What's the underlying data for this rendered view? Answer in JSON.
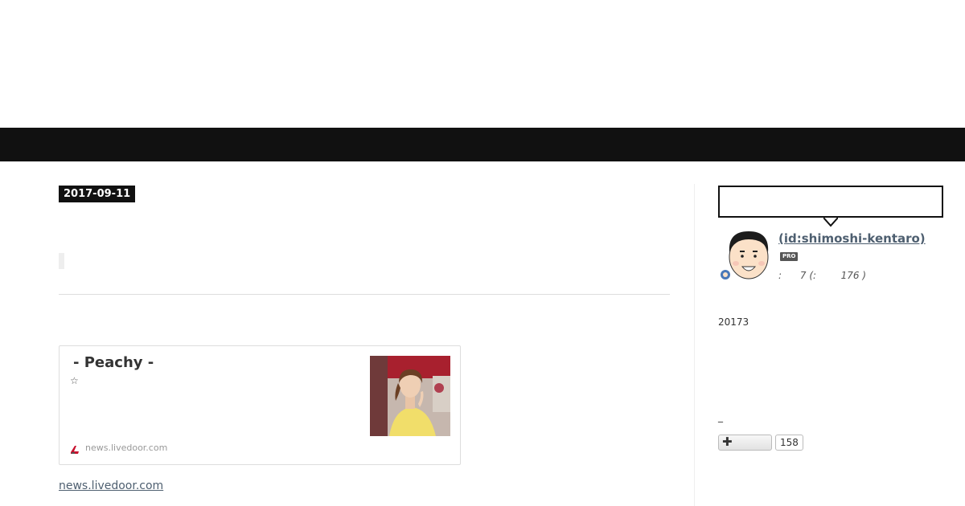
{
  "post": {
    "date": "2017-09-11"
  },
  "embed": {
    "title": " - Peachy -",
    "description": "☆",
    "site": "news.livedoor.com",
    "favicon": "livedoor-favicon-icon",
    "thumbnail": "woman-in-yellow-shirt-photo"
  },
  "source_link": "news.livedoor.com",
  "sidebar": {
    "profile": {
      "name": " (id:shimoshi-kentaro)",
      "badge": "PRO",
      "reader_line": ":      7 (:        176 )",
      "avatar": "cartoon-man-avatar-icon"
    },
    "since_text": "20173",
    "underscore_text": "_",
    "follow": {
      "icon": "plus-icon",
      "plus_glyph": "✚",
      "count": "158"
    }
  },
  "colors": {
    "nav_bar": "#111111",
    "date_badge": "#111111",
    "link": "#4e5f70"
  }
}
